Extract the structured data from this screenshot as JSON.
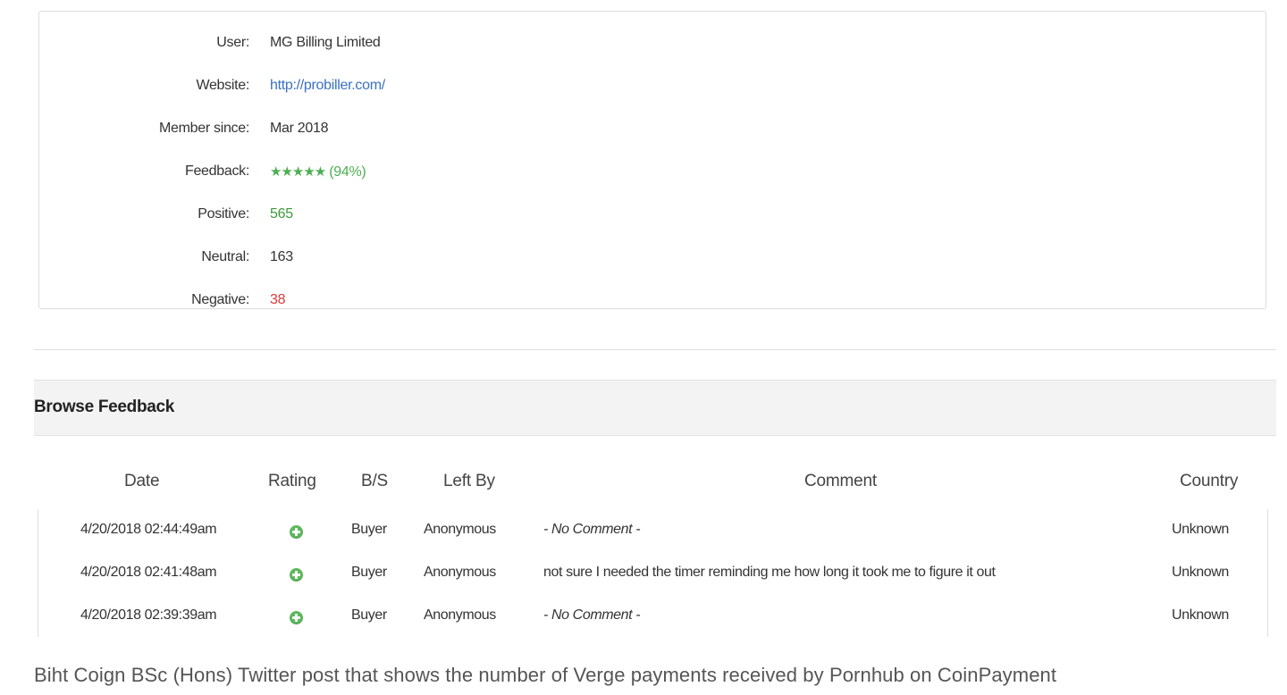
{
  "profile": {
    "user": {
      "label": "User:",
      "value": "MG Billing Limited"
    },
    "website": {
      "label": "Website:",
      "value": "http://probiller.com/"
    },
    "member_since": {
      "label": "Member since:",
      "value": "Mar 2018"
    },
    "feedback": {
      "label": "Feedback:",
      "stars": "★★★★★",
      "rating_stars": 5,
      "percent": "(94%)"
    },
    "positive": {
      "label": "Positive:",
      "value": "565"
    },
    "neutral": {
      "label": "Neutral:",
      "value": "163"
    },
    "negative": {
      "label": "Negative:",
      "value": "38"
    }
  },
  "section_title": "Browse Feedback",
  "table": {
    "headers": {
      "date": "Date",
      "rating": "Rating",
      "bs": "B/S",
      "left_by": "Left By",
      "comment": "Comment",
      "country": "Country"
    },
    "rows": [
      {
        "date": "4/20/2018 02:44:49am",
        "rating": "positive",
        "bs": "Buyer",
        "left_by": "Anonymous",
        "comment": "- No Comment -",
        "country": "Unknown"
      },
      {
        "date": "4/20/2018 02:41:48am",
        "rating": "positive",
        "bs": "Buyer",
        "left_by": "Anonymous",
        "comment": "not sure I needed the timer reminding me how long it took me to figure it out",
        "country": "Unknown"
      },
      {
        "date": "4/20/2018 02:39:39am",
        "rating": "positive",
        "bs": "Buyer",
        "left_by": "Anonymous",
        "comment": "- No Comment -",
        "country": "Unknown"
      }
    ]
  },
  "caption": "Biht Coign BSc (Hons) Twitter post that shows the number of Verge payments received by Pornhub on CoinPayment",
  "colors": {
    "positive": "#3c9b3c",
    "negative": "#e03a3a",
    "link": "#3a72c0",
    "star": "#4caf50"
  }
}
